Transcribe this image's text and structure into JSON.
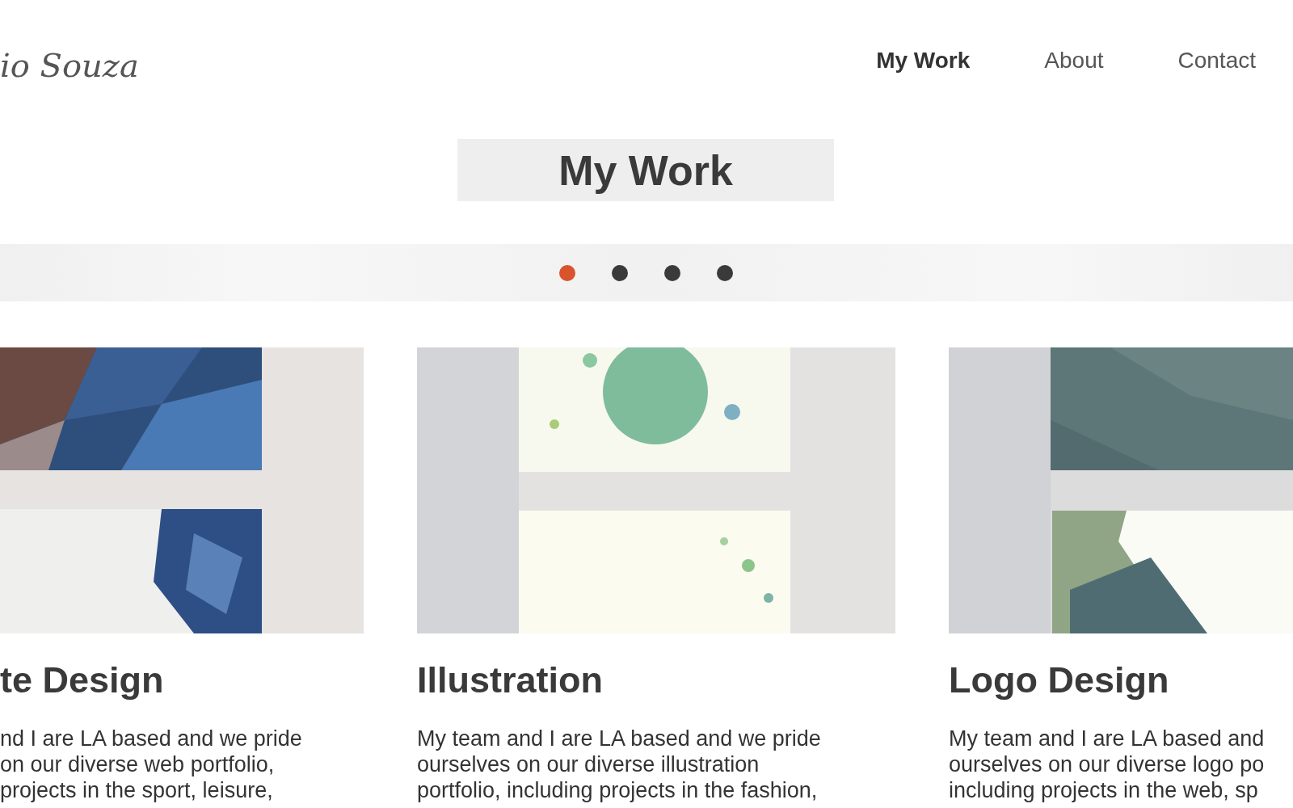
{
  "logo": "io Souza",
  "nav": [
    {
      "label": "My Work",
      "selected": true
    },
    {
      "label": "About",
      "selected": false
    },
    {
      "label": "Contact",
      "selected": false
    }
  ],
  "title": "My Work",
  "carousel": {
    "dots": [
      {
        "selected": true
      },
      {
        "selected": false
      },
      {
        "selected": false
      },
      {
        "selected": false
      }
    ]
  },
  "cards": [
    {
      "picture": {
        "kind": "picture"
      },
      "title": "te Design",
      "lines": [
        "nd I are LA based and we pride",
        "on our diverse web portfolio,",
        "projects in the sport, leisure,"
      ]
    },
    {
      "picture": {
        "kind": "picture"
      },
      "title": "Illustration",
      "lines": [
        "My team and I are LA based and we pride",
        "ourselves on our diverse illustration",
        "portfolio, including projects in the fashion,"
      ]
    },
    {
      "picture": {
        "kind": "picture"
      },
      "title": "Logo Design",
      "lines": [
        "My team and I are LA based and",
        "ourselves on our diverse logo po",
        "including projects in the web, sp"
      ]
    }
  ]
}
